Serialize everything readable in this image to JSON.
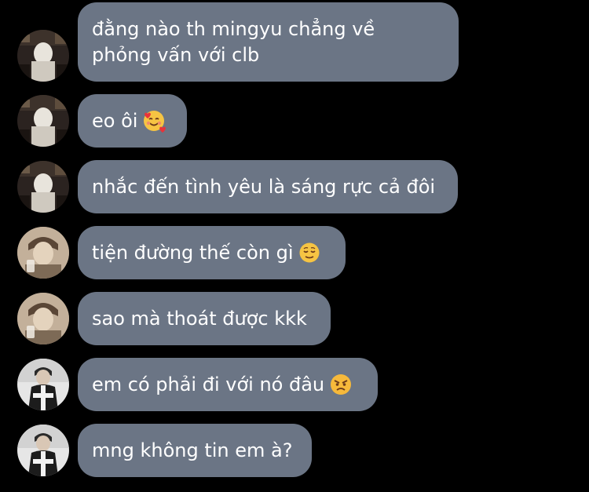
{
  "messages": [
    {
      "lines": [
        "đằng nào th mingyu chẳng về",
        "phỏng vấn với clb"
      ],
      "avatar": "dark-room-avatar",
      "emoji": null
    },
    {
      "lines": [
        "eo ôi"
      ],
      "avatar": "dark-room-avatar",
      "emoji": "smiling-face-with-hearts-icon"
    },
    {
      "lines": [
        "nhắc đến tình yêu là sáng rực cả đôi"
      ],
      "avatar": "dark-room-avatar",
      "emoji": null
    },
    {
      "lines": [
        "tiện đường thế còn gì"
      ],
      "avatar": "sepia-portrait-avatar",
      "emoji": "relieved-face-icon"
    },
    {
      "lines": [
        "sao mà thoát được kkk"
      ],
      "avatar": "sepia-portrait-avatar",
      "emoji": null
    },
    {
      "lines": [
        "em có phải đi với nó đâu"
      ],
      "avatar": "jacket-portrait-avatar",
      "emoji": "angry-face-icon"
    },
    {
      "lines": [
        "mng không tin em à?"
      ],
      "avatar": "jacket-portrait-avatar",
      "emoji": null
    }
  ],
  "colors": {
    "background": "#000000",
    "bubble": "#6b7585",
    "text": "#ffffff"
  }
}
